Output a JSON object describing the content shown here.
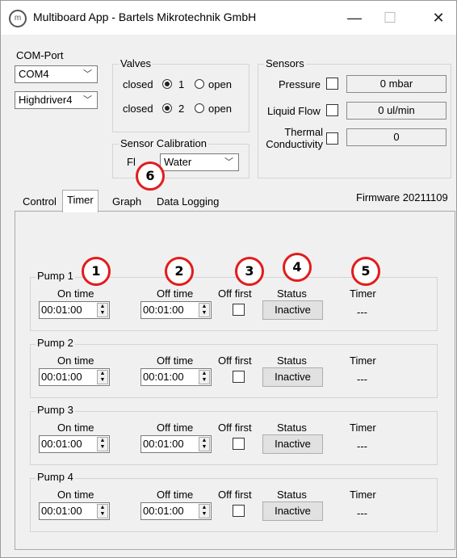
{
  "window": {
    "title": "Multiboard App - Bartels Mikrotechnik GmbH",
    "icon_glyph": "m",
    "minimize_glyph": "—",
    "maximize_glyph": "☐",
    "close_glyph": "✕"
  },
  "com_port": {
    "label": "COM-Port",
    "port_value": "COM4",
    "driver_value": "Highdriver4"
  },
  "valves": {
    "label": "Valves",
    "rows": [
      {
        "left_label": "closed",
        "number": "1",
        "right_label": "open",
        "selected": "closed"
      },
      {
        "left_label": "closed",
        "number": "2",
        "right_label": "open",
        "selected": "closed"
      }
    ]
  },
  "sensors": {
    "label": "Sensors",
    "pressure_label": "Pressure",
    "pressure_value": "0 mbar",
    "liquid_flow_label": "Liquid Flow",
    "liquid_flow_value": "0 ul/min",
    "thermal_label_line1": "Thermal",
    "thermal_label_line2": "Conductivity",
    "thermal_value": "0"
  },
  "sensor_calibration": {
    "label": "Sensor Calibration",
    "fluid_label": "Fl",
    "fluid_value": "Water"
  },
  "firmware": "Firmware 20211109",
  "tabs": [
    "Control",
    "Timer",
    "Graph",
    "Data Logging"
  ],
  "active_tab": "Timer",
  "columns": {
    "on_time": "On time",
    "off_time": "Off time",
    "off_first": "Off first",
    "status": "Status",
    "timer": "Timer"
  },
  "pumps": [
    {
      "name": "Pump 1",
      "on_time": "00:01:00",
      "off_time": "00:01:00",
      "off_first": false,
      "status": "Inactive",
      "timer": "---"
    },
    {
      "name": "Pump 2",
      "on_time": "00:01:00",
      "off_time": "00:01:00",
      "off_first": false,
      "status": "Inactive",
      "timer": "---"
    },
    {
      "name": "Pump 3",
      "on_time": "00:01:00",
      "off_time": "00:01:00",
      "off_first": false,
      "status": "Inactive",
      "timer": "---"
    },
    {
      "name": "Pump 4",
      "on_time": "00:01:00",
      "off_time": "00:01:00",
      "off_first": false,
      "status": "Inactive",
      "timer": "---"
    }
  ],
  "callouts": [
    "1",
    "2",
    "3",
    "4",
    "5",
    "6"
  ],
  "colors": {
    "callout_ring": "#e21c1c",
    "window_bg": "#f0f0f0"
  }
}
